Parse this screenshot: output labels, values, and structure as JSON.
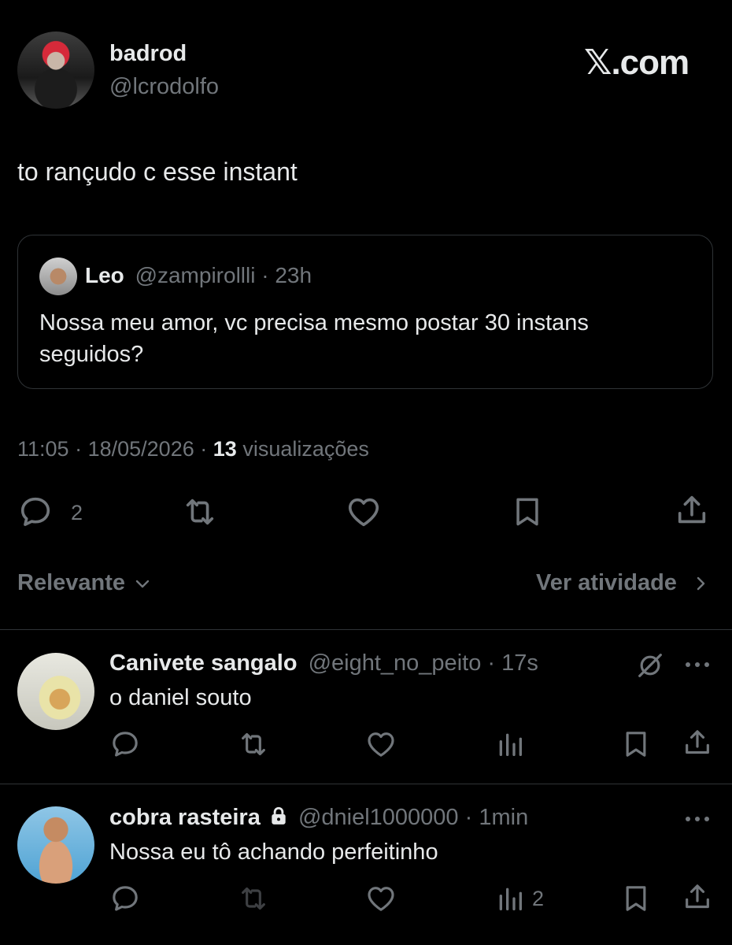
{
  "header": {
    "author_name": "badrod",
    "author_handle": "@lcrodolfo",
    "brand": "𝕏.com"
  },
  "tweet": {
    "text": "to rançudo c esse instant",
    "quoted": {
      "name": "Leo",
      "handle": "@zampirollli",
      "separator": "·",
      "time": "23h",
      "text_line1": "Nossa meu amor, vc precisa mesmo postar 30 instans",
      "text_line2": "seguidos?"
    },
    "meta": {
      "time": "11:05",
      "sep1": "·",
      "date": "18/05/2026",
      "sep2": "·",
      "views_count": "13",
      "views_label": "visualizações"
    },
    "actions": {
      "reply_count": "2"
    }
  },
  "sort_bar": {
    "sort_label": "Relevante",
    "activity_label": "Ver atividade"
  },
  "replies": [
    {
      "name": "Canivete sangalo",
      "handle": "@eight_no_peito",
      "separator": "·",
      "time": "17s",
      "text": "o daniel souto",
      "views_count": ""
    },
    {
      "name": "cobra rasteira",
      "handle": "@dniel1000000",
      "separator": "·",
      "time": "1min",
      "text": "Nossa eu tô achando perfeitinho",
      "views_count": "2"
    }
  ],
  "colors": {
    "background": "#000000",
    "text": "#e7e9ea",
    "muted": "#71767b",
    "border": "#2f3336"
  },
  "icons": [
    "reply-icon",
    "retweet-icon",
    "like-icon",
    "bookmark-icon",
    "share-icon",
    "views-icon",
    "more-icon",
    "grok-icon",
    "lock-icon",
    "chevron-down-icon",
    "chevron-right-icon"
  ]
}
